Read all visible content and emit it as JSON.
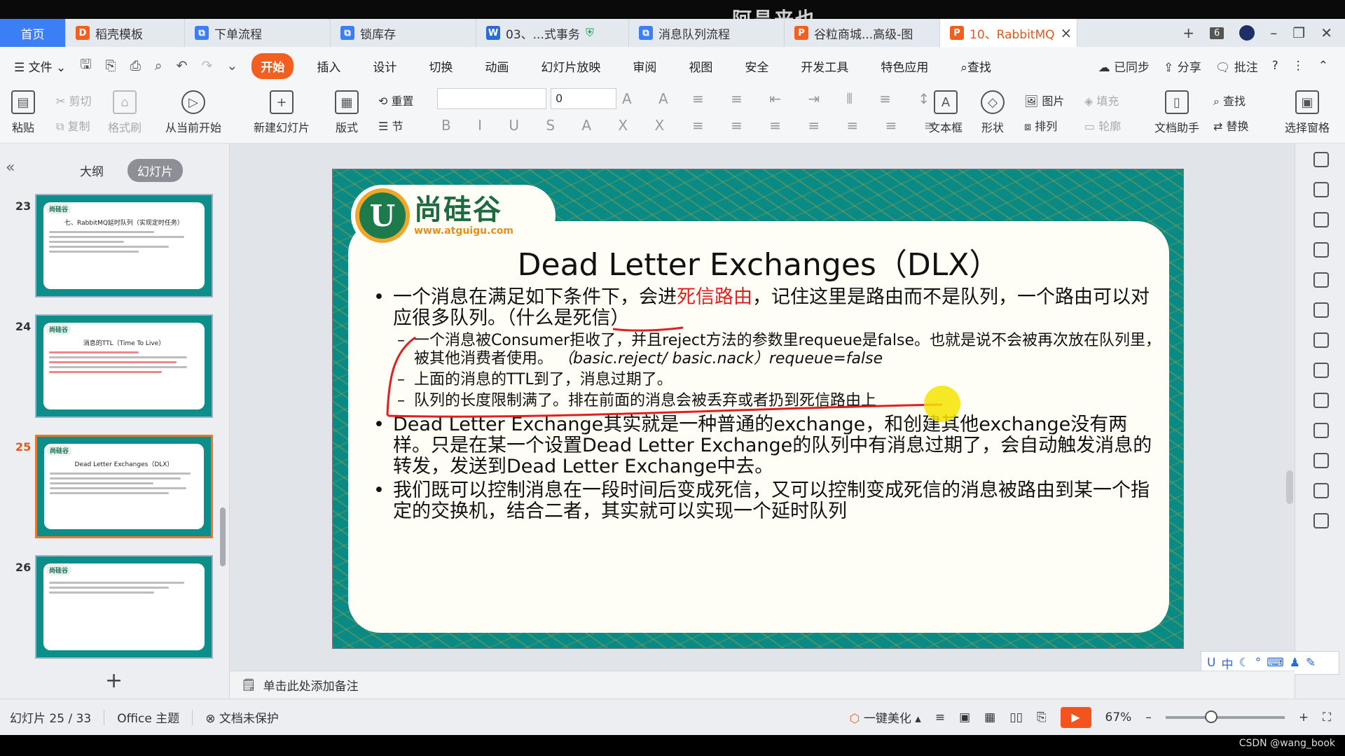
{
  "overlay": {
    "top_watermark": "阿昌来也",
    "bottom_watermark": "CSDN @wang_book"
  },
  "tabs": [
    {
      "label": "首页",
      "icon": "home",
      "color": "#3b7ef6"
    },
    {
      "label": "稻壳模板",
      "icon": "docer-icon",
      "color": "#f35f1f"
    },
    {
      "label": "下单流程",
      "icon": "flowchart-icon",
      "color": "#3b7ef6"
    },
    {
      "label": "锁库存",
      "icon": "flowchart-icon",
      "color": "#3b7ef6"
    },
    {
      "label": "03、...式事务",
      "icon": "word-icon",
      "color": "#2b6bd8"
    },
    {
      "label": "消息队列流程",
      "icon": "flowchart-icon",
      "color": "#3b7ef6"
    },
    {
      "label": "谷粒商城...高级-图",
      "icon": "ppt-icon",
      "color": "#f35f1f"
    },
    {
      "label": "10、RabbitMQ",
      "icon": "ppt-icon",
      "color": "#f35f1f"
    }
  ],
  "tab_count": "6",
  "menu": {
    "file": "文件",
    "items": [
      "开始",
      "插入",
      "设计",
      "切换",
      "动画",
      "幻灯片放映",
      "审阅",
      "视图",
      "安全",
      "开发工具",
      "特色应用"
    ],
    "active": "开始",
    "search": "查找",
    "synced": "已同步",
    "share": "分享",
    "comment": "批注"
  },
  "ribbon": {
    "paste": "粘贴",
    "cut": "剪切",
    "copy": "复制",
    "format_painter": "格式刷",
    "play_from_current": "从当前开始",
    "new_slide": "新建幻灯片",
    "layout": "版式",
    "reset": "重置",
    "section": "节",
    "font_size": "0",
    "text_box": "文本框",
    "shape": "形状",
    "picture": "图片",
    "arrange": "排列",
    "fill": "填充",
    "outline": "轮廓",
    "doc_helper": "文档助手",
    "find": "查找",
    "replace": "替换",
    "select_pane": "选择窗格"
  },
  "left_panel": {
    "tab_outline": "大纲",
    "tab_slides": "幻灯片",
    "active_tab": "幻灯片",
    "thumbnails": [
      {
        "num": "23",
        "title": "七、RabbitMQ延时队列（实现定时任务）",
        "selected": false
      },
      {
        "num": "24",
        "title": "消息的TTL（Time To Live）",
        "selected": false
      },
      {
        "num": "25",
        "title": "Dead Letter Exchanges（DLX）",
        "selected": true
      },
      {
        "num": "26",
        "title": "",
        "selected": false
      }
    ]
  },
  "slide": {
    "logo_name": "尚硅谷",
    "logo_url": "www.atguigu.com",
    "title": "Dead Letter Exchanges（DLX）",
    "b1_pre": "一个消息在满足如下条件下，会进",
    "b1_red": "死信路由",
    "b1_post": "，记住这里是路由而不是队列，一个路由可以对应很多队列。（什么是死信）",
    "s1": "一个消息被Consumer拒收了，并且reject方法的参数里requeue是false。也就是说不会被再次放在队列里，被其他消费者使用。",
    "s1_italic": "（basic.reject/ basic.nack）requeue=false",
    "s2": "上面的消息的TTL到了，消息过期了。",
    "s3": "队列的长度限制满了。排在前面的消息会被丢弃或者扔到死信路由上",
    "b2": "Dead Letter Exchange其实就是一种普通的exchange，和创建其他exchange没有两样。只是在某一个设置Dead Letter Exchange的队列中有消息过期了，会自动触发消息的转发，发送到Dead Letter Exchange中去。",
    "b3": "我们既可以控制消息在一段时间后变成死信，又可以控制变成死信的消息被路由到某一个指定的交换机，结合二者，其实就可以实现一个延时队列"
  },
  "notes_placeholder": "单击此处添加备注",
  "status": {
    "slide_info": "幻灯片 25 / 33",
    "theme": "Office 主题",
    "protect": "文档未保护",
    "beautify": "一键美化",
    "zoom": "67%"
  },
  "ime": {
    "lang": "中"
  },
  "colors": {
    "accent": "#f35f1f",
    "home_tab": "#3b7ef6",
    "slide_bg": "#0a8a84",
    "pen": "#e02020"
  }
}
